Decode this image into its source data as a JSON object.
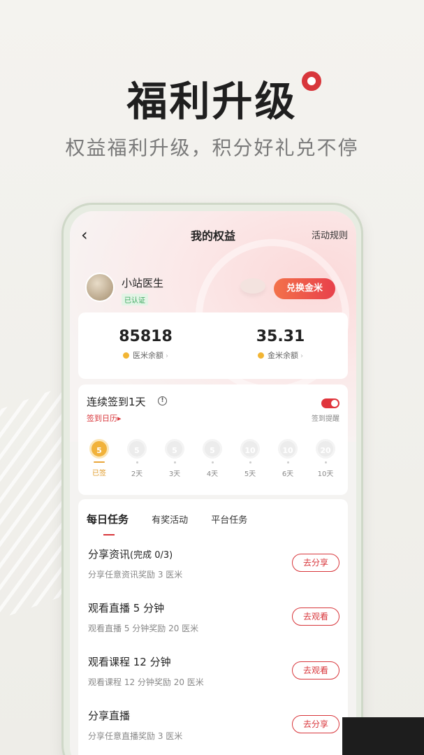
{
  "promo": {
    "title": "福利升级",
    "subtitle": "权益福利升级，积分好礼兑不停"
  },
  "nav": {
    "back_icon": "chevron-left-icon",
    "title": "我的权益",
    "rules": "活动规则"
  },
  "user": {
    "name": "小站医生",
    "badge": "已认证",
    "exchange_button": "兑换金米"
  },
  "balances": [
    {
      "value": "85818",
      "label": "医米余额"
    },
    {
      "value": "35.31",
      "label": "金米余额"
    }
  ],
  "signin": {
    "title": "连续签到1天",
    "calendar_link": "签到日历",
    "reminder_label": "签到提醒",
    "reminder_on": true,
    "days": [
      {
        "points": "5",
        "label": "已签",
        "active": true
      },
      {
        "points": "5",
        "label": "2天"
      },
      {
        "points": "5",
        "label": "3天"
      },
      {
        "points": "5",
        "label": "4天"
      },
      {
        "points": "10",
        "label": "5天"
      },
      {
        "points": "10",
        "label": "6天"
      },
      {
        "points": "20",
        "label": "10天"
      }
    ]
  },
  "tasks": {
    "tabs": [
      "每日任务",
      "有奖活动",
      "平台任务"
    ],
    "active_tab": 0,
    "items": [
      {
        "name": "分享资讯",
        "progress": "(完成 0/3)",
        "desc": "分享任意资讯奖励 3 医米",
        "button": "去分享"
      },
      {
        "name": "观看直播 5 分钟",
        "progress": "",
        "desc": "观看直播 5 分钟奖励 20 医米",
        "button": "去观看"
      },
      {
        "name": "观看课程 12 分钟",
        "progress": "",
        "desc": "观看课程 12 分钟奖励 20 医米",
        "button": "去观看"
      },
      {
        "name": "分享直播",
        "progress": "",
        "desc": "分享任意直播奖励 3 医米",
        "button": "去分享"
      }
    ]
  },
  "colors": {
    "accent": "#d8363b",
    "coin": "#f1b23a"
  }
}
